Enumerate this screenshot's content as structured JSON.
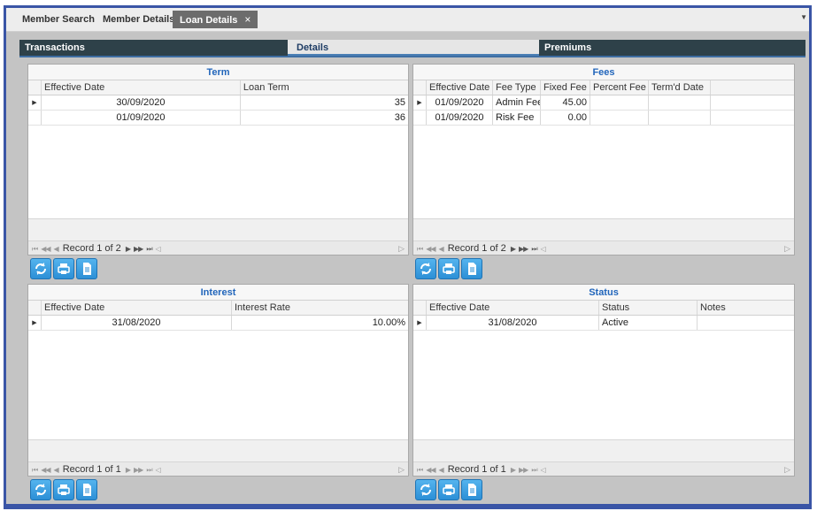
{
  "doc_tabs": [
    {
      "label": "Member Search"
    },
    {
      "label": "Member Details"
    },
    {
      "label": "Loan Details",
      "close": "×"
    }
  ],
  "section_tabs": [
    "Transactions",
    "Details",
    "Premiums"
  ],
  "panels": {
    "term": {
      "title": "Term",
      "headers": [
        "Effective Date",
        "Loan Term"
      ],
      "rows": [
        [
          "30/09/2020",
          "35"
        ],
        [
          "01/09/2020",
          "36"
        ]
      ],
      "record": "Record 1 of 2"
    },
    "fees": {
      "title": "Fees",
      "headers": [
        "Effective Date",
        "Fee Type",
        "Fixed Fee",
        "Percent Fee",
        "Term'd Date"
      ],
      "rows": [
        [
          "01/09/2020",
          "Admin Fee",
          "45.00",
          "",
          ""
        ],
        [
          "01/09/2020",
          "Risk Fee",
          "0.00",
          "",
          ""
        ]
      ],
      "record": "Record 1 of 2"
    },
    "interest": {
      "title": "Interest",
      "headers": [
        "Effective Date",
        "Interest Rate"
      ],
      "rows": [
        [
          "31/08/2020",
          "10.00%"
        ]
      ],
      "record": "Record 1 of 1"
    },
    "status": {
      "title": "Status",
      "headers": [
        "Effective Date",
        "Status",
        "Notes"
      ],
      "rows": [
        [
          "31/08/2020",
          "Active",
          ""
        ]
      ],
      "record": "Record 1 of 1"
    }
  },
  "icons": {
    "row_indicator": "triangle-right",
    "buttons": [
      "refresh-icon",
      "print-icon",
      "document-icon"
    ],
    "nav": [
      "first",
      "prev-page",
      "prev",
      "next",
      "next-page",
      "last"
    ]
  },
  "colors": {
    "frame": "#3a55a6",
    "panel_title": "#2266bb",
    "button": "#2c8fd6",
    "dark_tab": "#2e4149"
  }
}
